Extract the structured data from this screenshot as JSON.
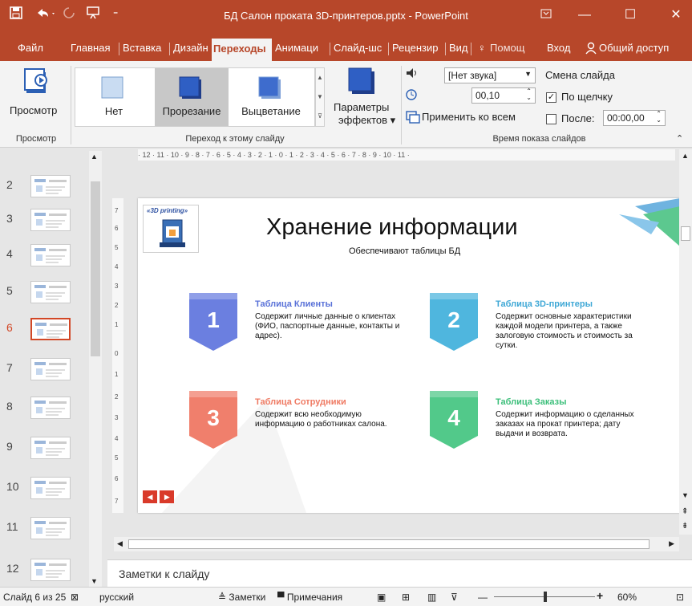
{
  "app": {
    "title": "БД Салон проката 3D-принтеров.pptx  -  PowerPoint",
    "save_icon": "save-icon",
    "undo_icon": "undo-icon",
    "redo_icon": "redo-icon",
    "present_icon": "present-from-start-icon"
  },
  "tabs": [
    {
      "label": "Файл"
    },
    {
      "label": "Главная"
    },
    {
      "label": "Вставка"
    },
    {
      "label": "Дизайн"
    },
    {
      "label": "Переходы",
      "display": "Переходы"
    },
    {
      "label": "Анимаци"
    },
    {
      "label": "Слайд-шс"
    },
    {
      "label": "Рецензир"
    },
    {
      "label": "Вид"
    },
    {
      "label": "Помощ"
    },
    {
      "label": "Вход"
    },
    {
      "label": "Общий доступ"
    }
  ],
  "ribbon": {
    "preview_label": "Просмотр",
    "preview_group": "Просмотр",
    "transitions": [
      {
        "label": "Нет"
      },
      {
        "label": "Прорезание",
        "selected": true
      },
      {
        "label": "Выцветание"
      }
    ],
    "effects_label_1": "Параметры",
    "effects_label_2": "эффектов",
    "transition_group": "Переход к этому слайду",
    "sound_value": "[Нет звука]",
    "duration_value": "00,10",
    "apply_all": "Применить ко всем",
    "advance_label": "Смена слайда",
    "on_click_label": "По щелчку",
    "on_click_checked": true,
    "after_label": "После:",
    "after_value": "00:00,00",
    "after_checked": false,
    "timing_group": "Время показа слайдов"
  },
  "ruler_text": "· 12 · 11 · 10 · 9 · 8 · 7 · 6 · 5 · 4 · 3 · 2 · 1 · 0 · 1 · 2 · 3 · 4 · 5 · 6 · 7 · 8 · 9 · 10 · 11 ·",
  "thumbnails": [
    {
      "num": "2"
    },
    {
      "num": "3"
    },
    {
      "num": "4"
    },
    {
      "num": "5"
    },
    {
      "num": "6",
      "selected": true
    },
    {
      "num": "7"
    },
    {
      "num": "8"
    },
    {
      "num": "9"
    },
    {
      "num": "10"
    },
    {
      "num": "11"
    },
    {
      "num": "12"
    }
  ],
  "slide": {
    "logo_text": "«3D printing»",
    "title": "Хранение информации",
    "subtitle": "Обеспечивают таблицы БД",
    "items": [
      {
        "num": "1",
        "heading": "Таблица Клиенты",
        "text": "Содержит личные данные о клиентах (ФИО, паспортные данные, контакты и адрес).",
        "color": "#6b7fe0",
        "heading_color": "#5a72d8"
      },
      {
        "num": "2",
        "heading": "Таблица 3D-принтеры",
        "text": "Содержит основные характеристики каждой модели принтера, а также залоговую стоимость и стоимость за сутки.",
        "color": "#4fb6de",
        "heading_color": "#3fa8d6"
      },
      {
        "num": "3",
        "heading": "Таблица Сотрудники",
        "text": "Содержит всю необходимую информацию о работниках салона.",
        "color": "#f07f6c",
        "heading_color": "#ef7a63"
      },
      {
        "num": "4",
        "heading": "Таблица Заказы",
        "text": "Содержит информацию о сделанных заказах на прокат принтера; дату выдачи и возврата.",
        "color": "#52c98a",
        "heading_color": "#3cbf7a"
      }
    ]
  },
  "notes_placeholder": "Заметки к слайду",
  "status": {
    "slide_count": "Слайд 6 из 25",
    "language": "русский",
    "notes": "Заметки",
    "comments": "Примечания",
    "zoom": "60%"
  }
}
